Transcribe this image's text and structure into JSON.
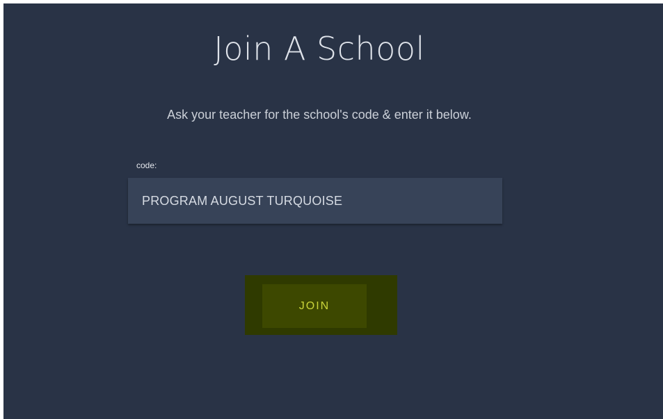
{
  "page": {
    "title": "Join A School",
    "subtitle": "Ask your teacher for the school's code & enter it below."
  },
  "form": {
    "code_label": "code:",
    "code_value": "PROGRAM AUGUST TURQUOISE"
  },
  "actions": {
    "join_label": "JOIN"
  },
  "colors": {
    "background": "#293346",
    "input_background": "#374358",
    "button_outer": "#2f3a00",
    "button_inner": "#3d4800",
    "button_text": "#c9d43a"
  }
}
